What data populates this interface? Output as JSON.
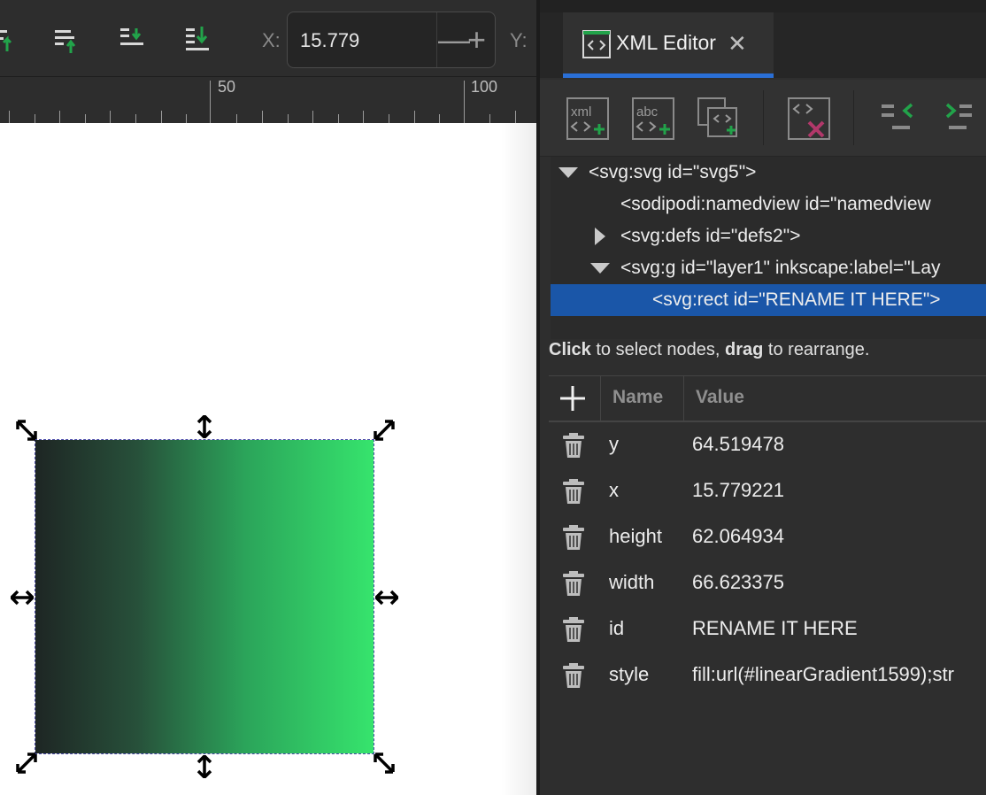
{
  "toolbar": {
    "x_label": "X:",
    "x_value": "15.779",
    "x_minus": "—",
    "x_plus": "+",
    "y_label": "Y:"
  },
  "ruler": {
    "labels": [
      "50",
      "100"
    ]
  },
  "xml_editor": {
    "tab_title": "XML Editor",
    "tab_close": "✕",
    "tree": [
      {
        "text": "<svg:svg id=\"svg5\">",
        "expanded": true
      },
      {
        "text": "<sodipodi:namedview id=\"namedview"
      },
      {
        "text": "<svg:defs id=\"defs2\">",
        "expanded": false
      },
      {
        "text": "<svg:g id=\"layer1\" inkscape:label=\"Lay",
        "expanded": true
      },
      {
        "text": "<svg:rect id=\"RENAME IT HERE\">",
        "selected": true
      }
    ],
    "hint_click": "Click",
    "hint_mid": " to select nodes, ",
    "hint_drag": "drag",
    "hint_end": " to rearrange.",
    "columns": {
      "name": "Name",
      "value": "Value"
    },
    "attributes": [
      {
        "name": "y",
        "value": "64.519478"
      },
      {
        "name": "x",
        "value": "15.779221"
      },
      {
        "name": "height",
        "value": "62.064934"
      },
      {
        "name": "width",
        "value": "66.623375"
      },
      {
        "name": "id",
        "value": "RENAME IT HERE"
      },
      {
        "name": "style",
        "value": "fill:url(#linearGradient1599);str"
      }
    ]
  },
  "colors": {
    "selection": "#1a56a8",
    "tab_underline": "#2a6fd6",
    "gradient_start": "#1e2624",
    "gradient_end": "#36e46d",
    "accent_green": "#22a34a",
    "delete_red": "#b2386a"
  },
  "icons": [
    "align-raise-icon",
    "raise-to-top-icon",
    "lower-icon",
    "lower-to-bottom-icon",
    "xml-editor-icon",
    "new-element-node-icon",
    "new-text-node-icon",
    "duplicate-node-icon",
    "delete-node-icon",
    "unindent-node-icon",
    "indent-node-icon",
    "add-attribute-icon",
    "trash-icon",
    "scale-handle-icon"
  ]
}
